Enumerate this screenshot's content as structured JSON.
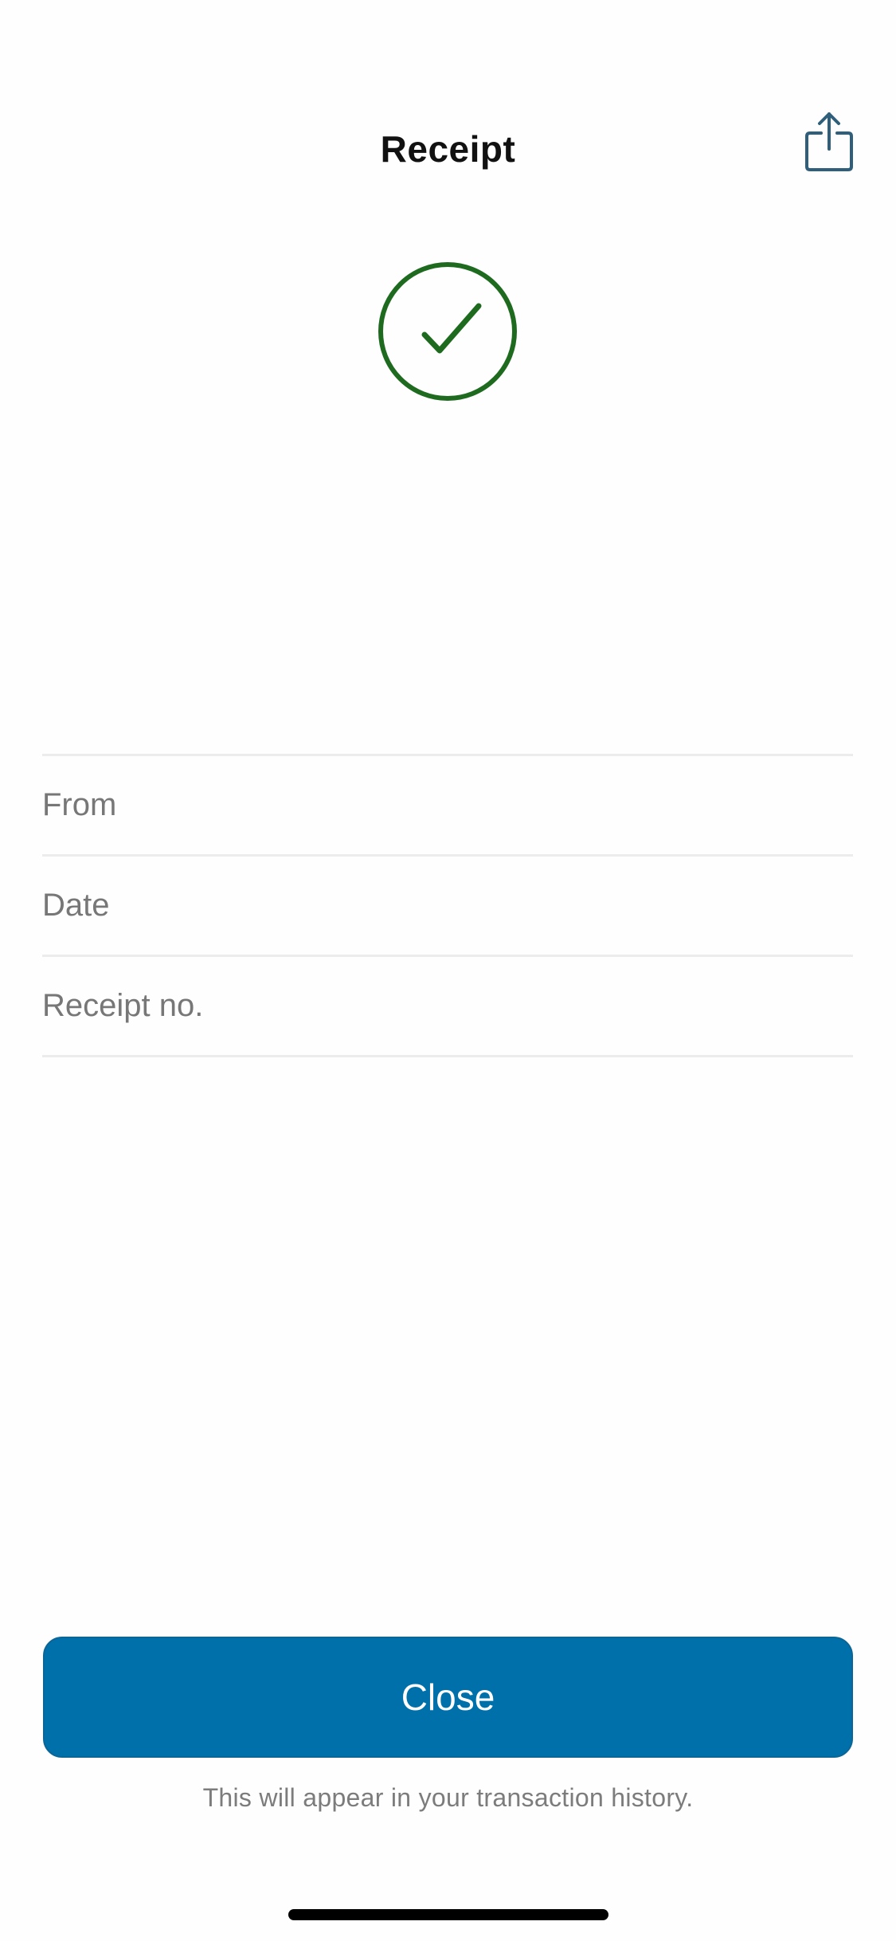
{
  "header": {
    "title": "Receipt",
    "share_icon": "share-icon"
  },
  "status": {
    "icon": "checkmark-circle-icon",
    "color": "#1e6b20"
  },
  "details": {
    "rows": [
      {
        "label": "From",
        "value": ""
      },
      {
        "label": "Date",
        "value": ""
      },
      {
        "label": "Receipt no.",
        "value": ""
      }
    ]
  },
  "actions": {
    "close_label": "Close",
    "close_color": "#0070ab"
  },
  "footer": {
    "note": "This will appear in your transaction history."
  }
}
